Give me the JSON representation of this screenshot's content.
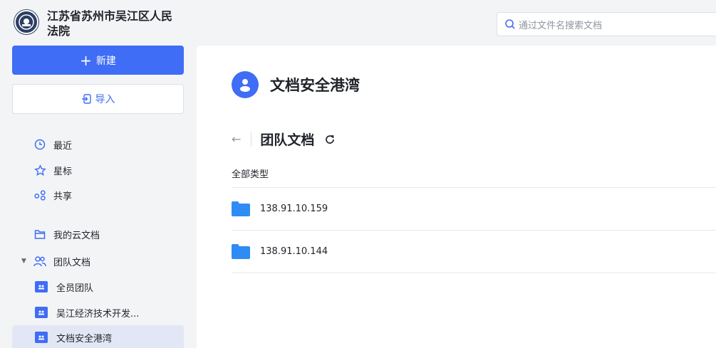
{
  "org": {
    "name": "江苏省苏州市吴江区人民法院"
  },
  "actions": {
    "new_label": "新建",
    "import_label": "导入"
  },
  "nav": {
    "recent": "最近",
    "starred": "星标",
    "shared": "共享",
    "my_cloud_docs": "我的云文档",
    "team_docs": "团队文档",
    "teams": [
      "全员团队",
      "吴江经济技术开发...",
      "文档安全港湾"
    ]
  },
  "search": {
    "placeholder": "通过文件名搜索文档"
  },
  "space": {
    "title": "文档安全港湾"
  },
  "breadcrumb": {
    "title": "团队文档"
  },
  "filter": {
    "label": "全部类型"
  },
  "files": [
    {
      "name": "138.91.10.159",
      "icon": "folder-icon"
    },
    {
      "name": "138.91.10.144",
      "icon": "folder-icon"
    }
  ],
  "colors": {
    "accent": "#3f6df5",
    "folder": "#2f8cf4"
  }
}
